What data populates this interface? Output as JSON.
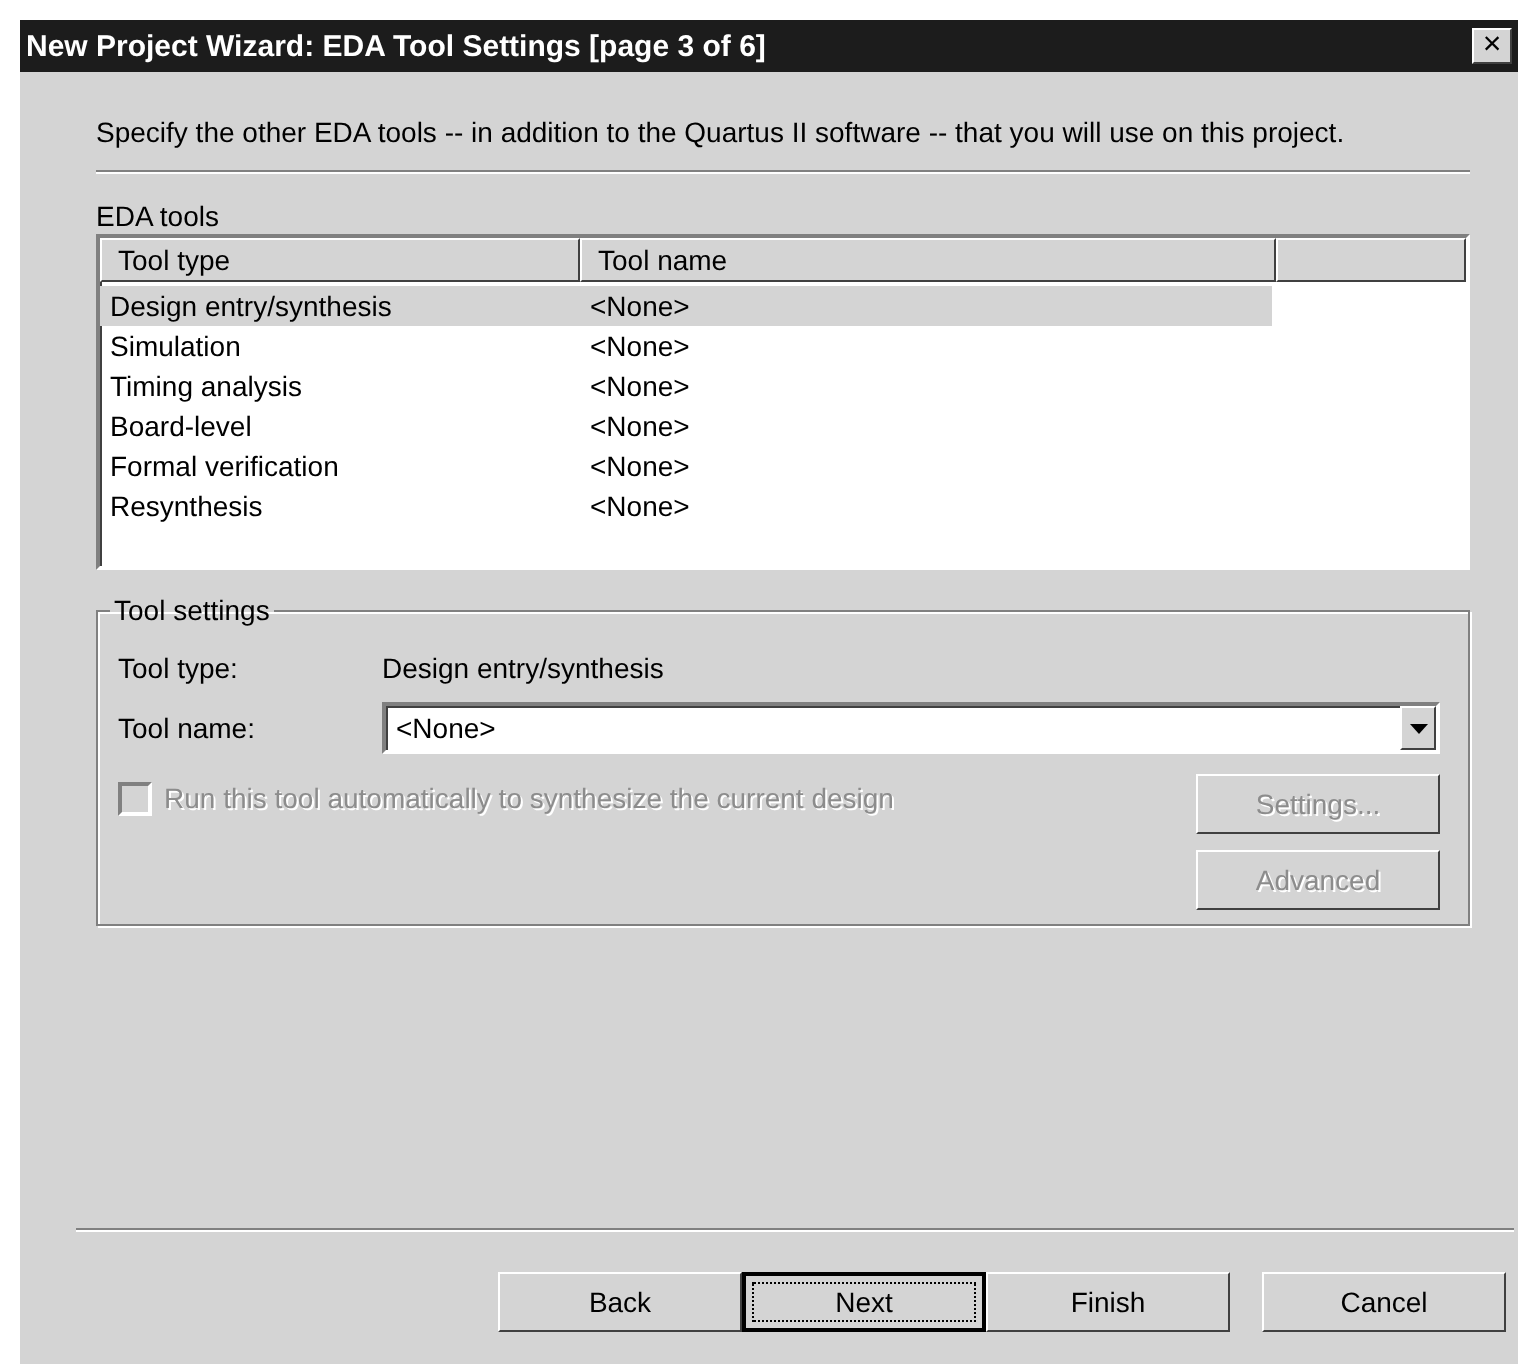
{
  "window": {
    "title": "New Project Wizard: EDA Tool Settings [page 3 of 6]",
    "close": "×"
  },
  "intro": "Specify the other EDA tools -- in addition to the Quartus II software -- that you will use on this project.",
  "eda_tools": {
    "label": "EDA tools",
    "columns": [
      "Tool type",
      "Tool name"
    ],
    "rows": [
      {
        "type": "Design entry/synthesis",
        "name": "<None>",
        "selected": true
      },
      {
        "type": "Simulation",
        "name": "<None>",
        "selected": false
      },
      {
        "type": "Timing analysis",
        "name": "<None>",
        "selected": false
      },
      {
        "type": "Board-level",
        "name": "<None>",
        "selected": false
      },
      {
        "type": "Formal verification",
        "name": "<None>",
        "selected": false
      },
      {
        "type": "Resynthesis",
        "name": "<None>",
        "selected": false
      }
    ]
  },
  "tool_settings": {
    "title": "Tool settings",
    "type_label": "Tool type:",
    "type_value": "Design entry/synthesis",
    "name_label": "Tool name:",
    "name_value": "<None>",
    "checkbox": {
      "label": "Run this tool automatically to synthesize the current design",
      "checked": false,
      "disabled": true
    },
    "buttons": [
      {
        "label": "Settings...",
        "disabled": true
      },
      {
        "label": "Advanced",
        "disabled": true
      }
    ]
  },
  "footer_buttons": [
    {
      "label": "Back",
      "default": false
    },
    {
      "label": "Next",
      "default": true
    },
    {
      "label": "Finish",
      "default": false
    },
    {
      "label": "Cancel",
      "default": false
    }
  ]
}
